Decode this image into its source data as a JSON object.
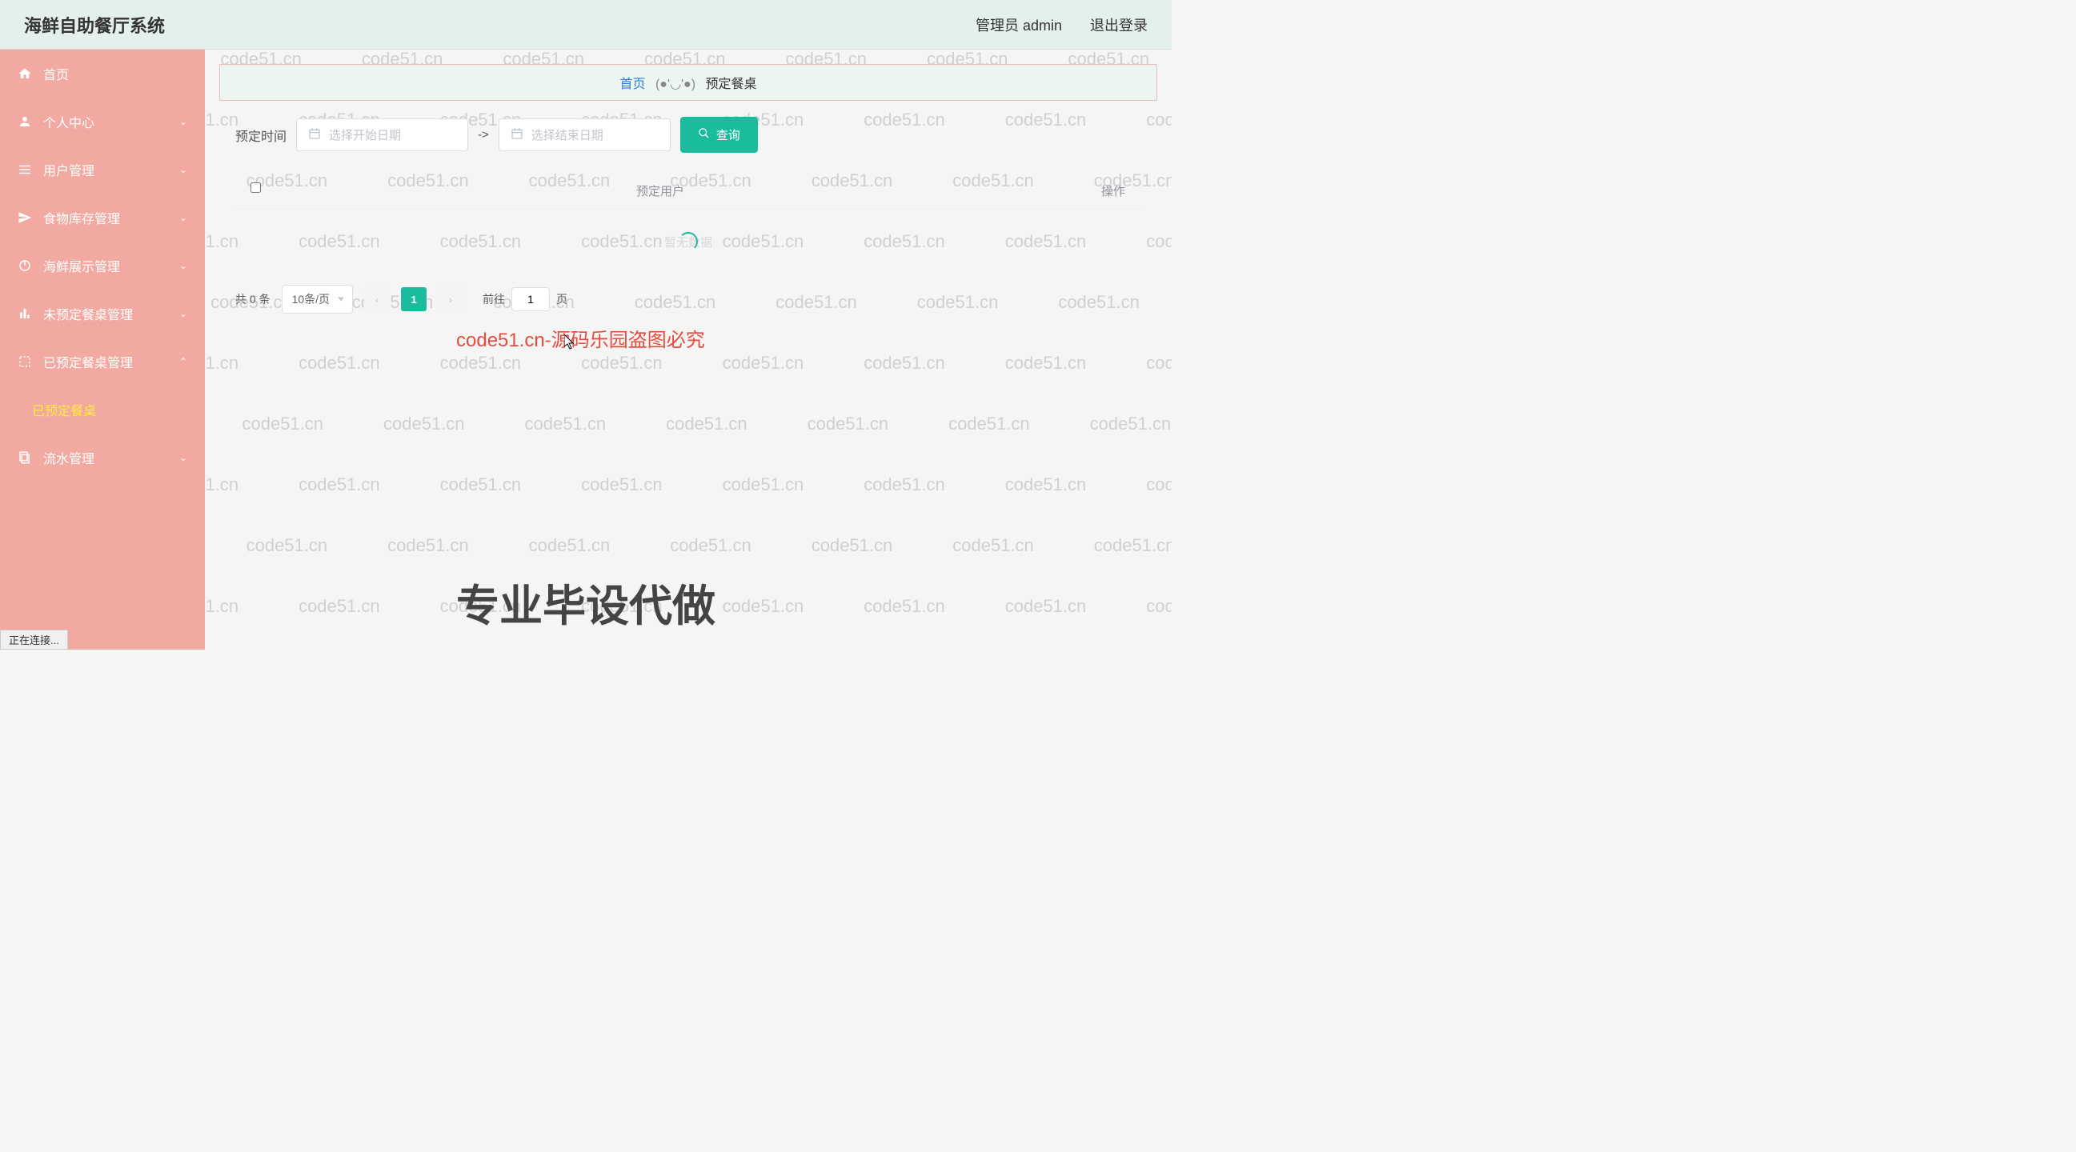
{
  "watermark": "code51.cn",
  "header": {
    "title": "海鲜自助餐厅系统",
    "user_label": "管理员 admin",
    "logout_label": "退出登录"
  },
  "sidebar": {
    "items": [
      {
        "label": "首页",
        "icon": "home"
      },
      {
        "label": "个人中心",
        "icon": "user",
        "chevron": "down"
      },
      {
        "label": "用户管理",
        "icon": "list",
        "chevron": "down"
      },
      {
        "label": "食物库存管理",
        "icon": "send",
        "chevron": "down"
      },
      {
        "label": "海鲜展示管理",
        "icon": "power",
        "chevron": "down"
      },
      {
        "label": "未预定餐桌管理",
        "icon": "bar",
        "chevron": "down"
      },
      {
        "label": "已预定餐桌管理",
        "icon": "expand",
        "chevron": "up"
      },
      {
        "label": "已预定餐桌",
        "sub": true
      },
      {
        "label": "流水管理",
        "icon": "copy",
        "chevron": "down"
      }
    ]
  },
  "breadcrumb": {
    "home": "首页",
    "sep": "(●'◡'●)",
    "current": "预定餐桌"
  },
  "search": {
    "label": "预定时间",
    "start_placeholder": "选择开始日期",
    "arrow": "->",
    "end_placeholder": "选择结束日期",
    "button": "查询"
  },
  "table": {
    "col_user": "预定用户",
    "col_action": "操作",
    "empty": "暂无数据"
  },
  "pagination": {
    "total": "共 0 条",
    "per_page": "10条/页",
    "current": "1",
    "goto_prefix": "前往",
    "goto_value": "1",
    "goto_suffix": "页"
  },
  "overlay": {
    "red_text": "code51.cn-源码乐园盗图必究",
    "big_text": "专业毕设代做"
  },
  "status_bar": "正在连接..."
}
